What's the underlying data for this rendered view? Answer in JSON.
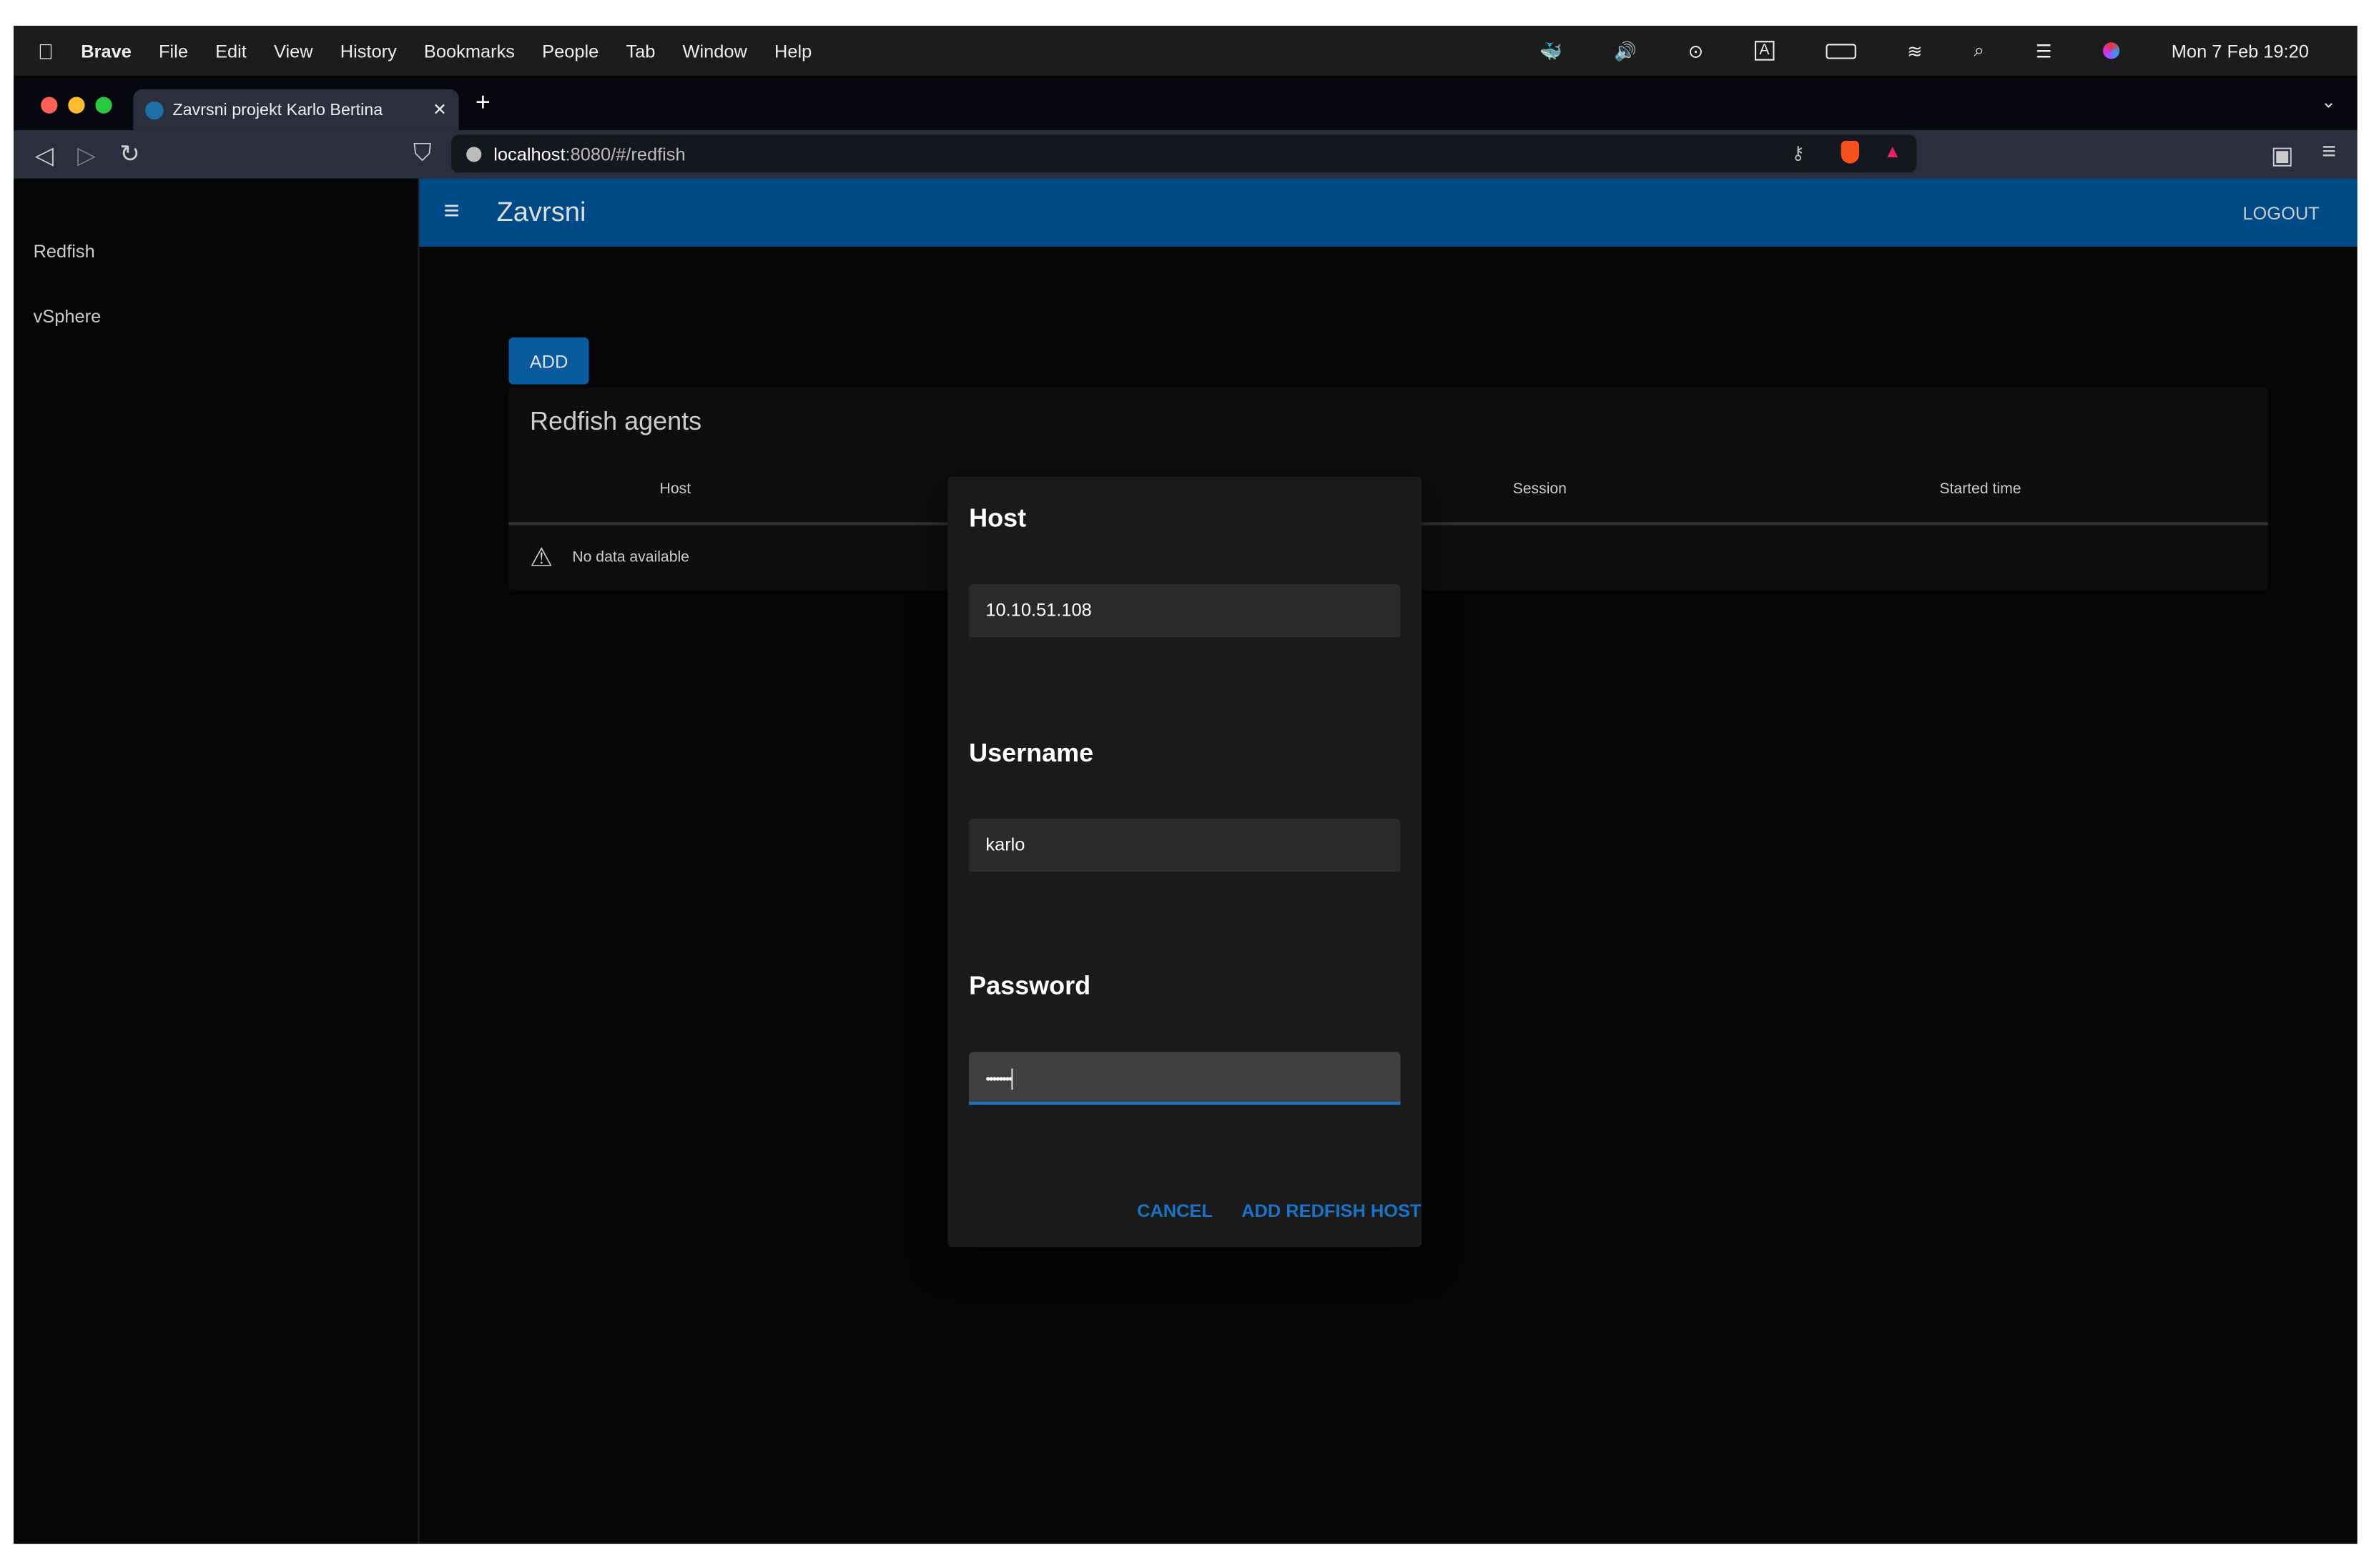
{
  "menubar": {
    "app": "Brave",
    "items": [
      "File",
      "Edit",
      "View",
      "History",
      "Bookmarks",
      "People",
      "Tab",
      "Window",
      "Help"
    ],
    "clock": "Mon 7 Feb  19:20"
  },
  "browser": {
    "tab_title": "Zavrsni projekt Karlo Bertina",
    "url_host": "localhost",
    "url_rest": ":8080/#/redfish"
  },
  "sidebar": {
    "items": [
      {
        "label": "Redfish"
      },
      {
        "label": "vSphere"
      }
    ]
  },
  "appbar": {
    "title": "Zavrsni",
    "logout": "LOGOUT"
  },
  "main": {
    "add_label": "ADD",
    "card_title": "Redfish agents",
    "columns": [
      "Host",
      "Session",
      "Started time"
    ],
    "empty_text": "No data available"
  },
  "dialog": {
    "host_label": "Host",
    "host_value": "10.10.51.108",
    "username_label": "Username",
    "username_value": "karlo",
    "password_label": "Password",
    "password_value": "••••••••",
    "cancel": "CANCEL",
    "submit": "ADD REDFISH HOST"
  },
  "colors": {
    "appbar": "#004a87",
    "accent": "#1a73c8"
  }
}
